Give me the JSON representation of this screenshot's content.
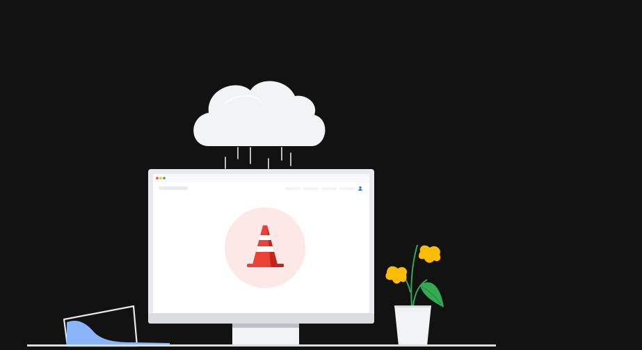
{
  "scene": {
    "icon": "offline-error-illustration",
    "colors": {
      "background": "#121212",
      "cloud": "#f1f3f4",
      "monitor_frame": "#e8eaed",
      "screen": "#ffffff",
      "cone_bg": "#fce8e6",
      "cone_red": "#ea4335",
      "cone_dark": "#c5221f",
      "flower_yellow": "#fbbc04",
      "leaf_green": "#34a853",
      "chart_blue": "#8ab4f8",
      "desk_line": "#dadce0"
    },
    "window_dots": [
      "#ea4335",
      "#fbbc04",
      "#34a853"
    ]
  }
}
